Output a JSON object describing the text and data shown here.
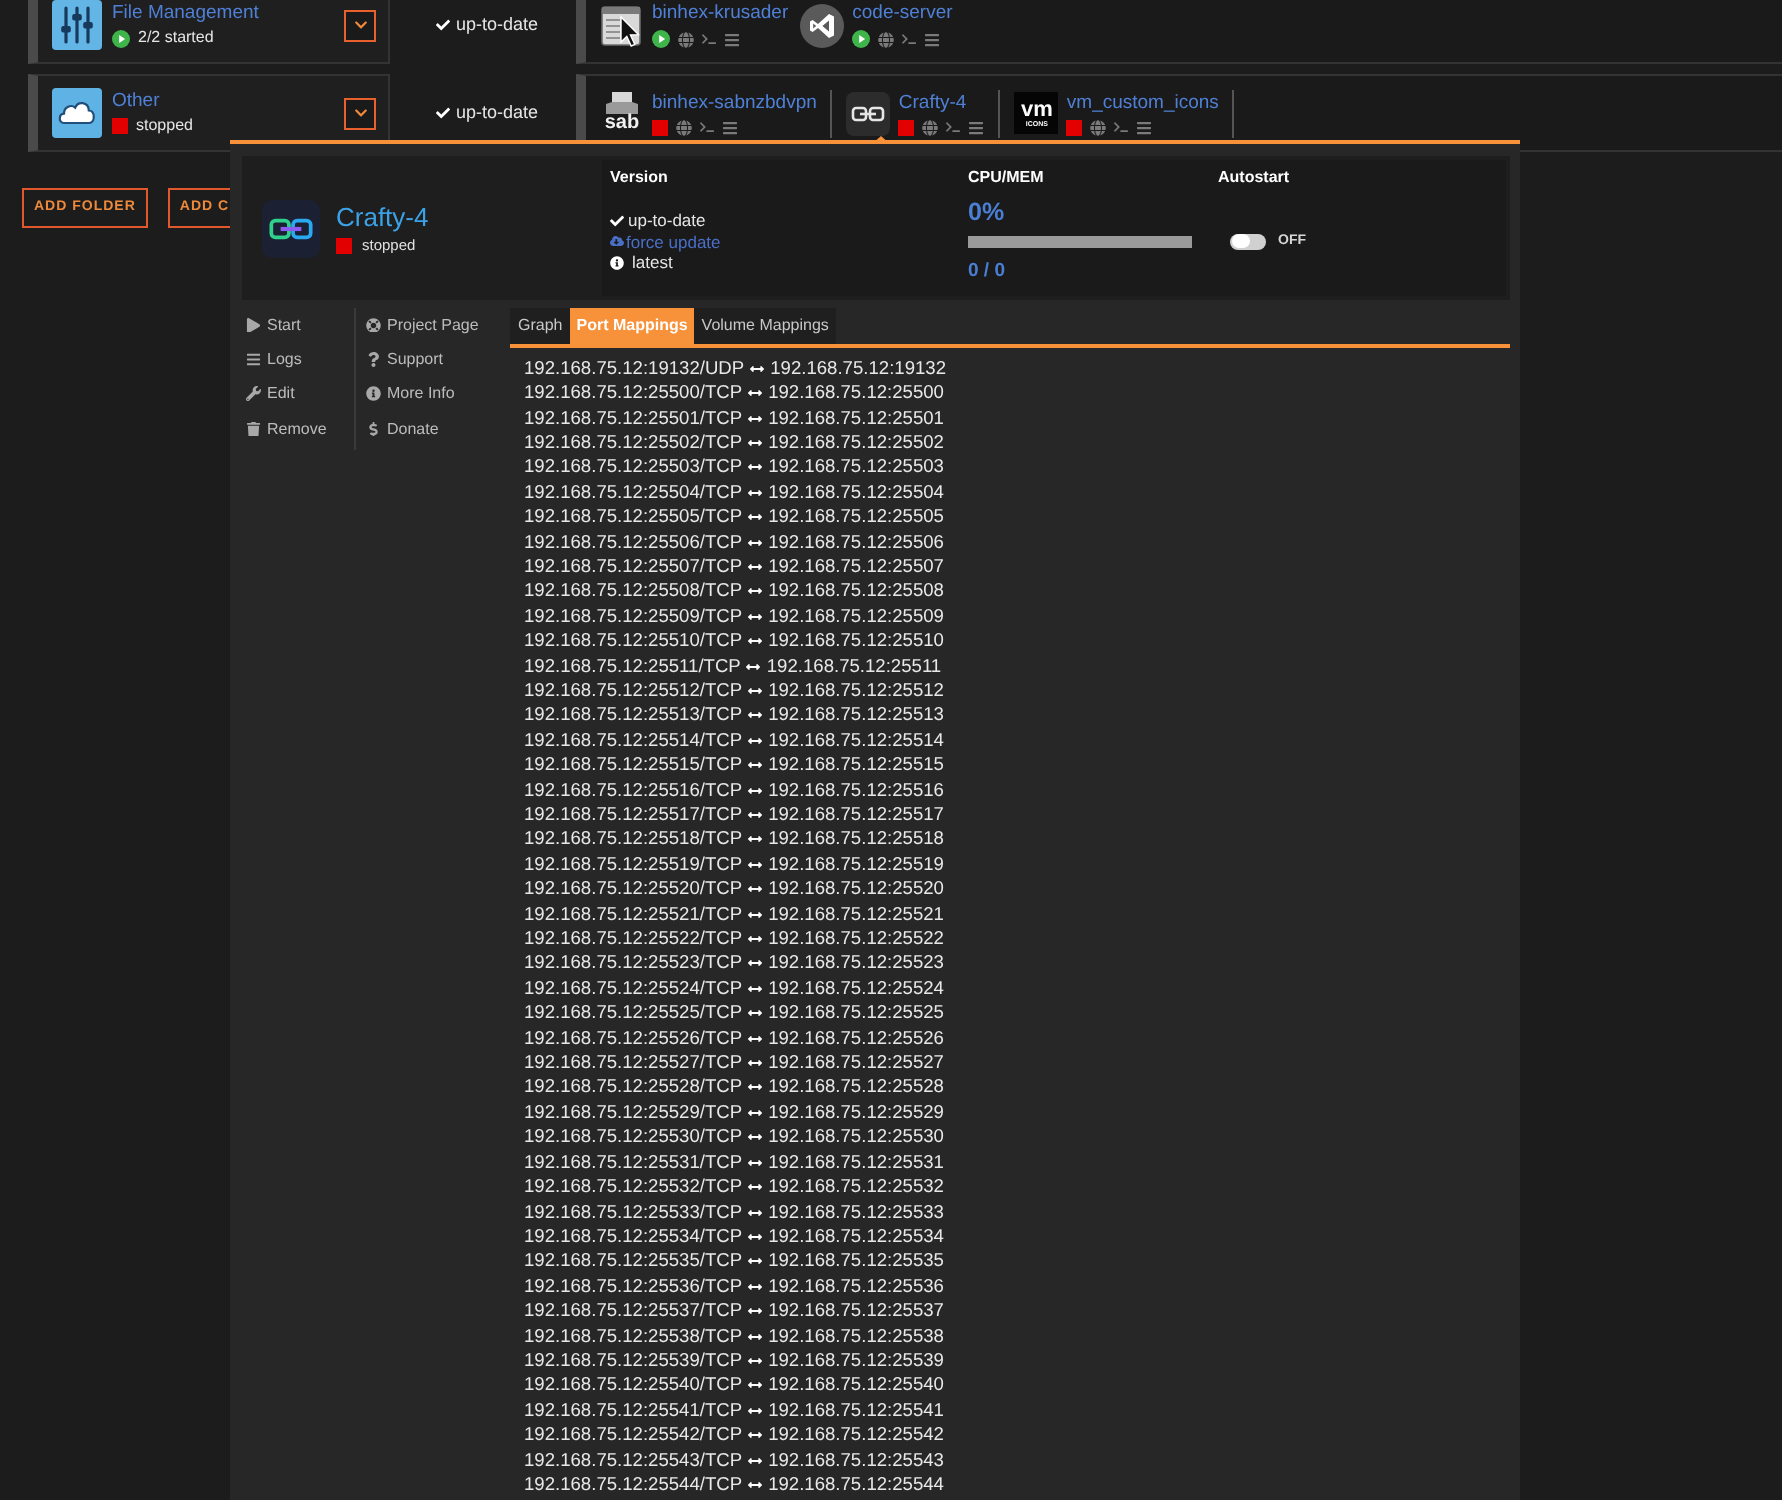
{
  "folders": [
    {
      "name": "File Management",
      "status": {
        "running": true,
        "text": "2/2 started"
      },
      "update": "up-to-date",
      "separators": false,
      "containers": [
        {
          "name": "binhex-krusader",
          "logo": {
            "kind": "krusader"
          },
          "running": true,
          "selected": false
        },
        {
          "name": "code-server",
          "logo": {
            "kind": "code"
          },
          "running": true,
          "selected": false
        }
      ]
    },
    {
      "name": "Other",
      "status": {
        "running": false,
        "text": "stopped"
      },
      "update": "up-to-date",
      "separators": true,
      "containers": [
        {
          "name": "binhex-sabnzbdvpn",
          "logo": {
            "kind": "sab",
            "text": [
              "sab"
            ]
          },
          "running": false,
          "selected": false
        },
        {
          "name": "Crafty-4",
          "logo": {
            "kind": "link"
          },
          "running": false,
          "selected": true
        },
        {
          "name": "vm_custom_icons",
          "logo": {
            "kind": "vm",
            "text": [
              "vm",
              "ICONS"
            ]
          },
          "running": false,
          "selected": false
        }
      ]
    }
  ],
  "buttons": [
    "ADD FOLDER",
    "ADD C"
  ],
  "popup": {
    "name": "Crafty-4",
    "running": false,
    "status": "stopped",
    "info": [
      {
        "kind": "version",
        "heading": "Version",
        "lines": [
          {
            "kind": "check",
            "text": "up-to-date"
          },
          {
            "kind": "link",
            "text": "force update"
          },
          {
            "kind": "info",
            "text": "latest"
          }
        ]
      },
      {
        "kind": "usage",
        "heading": "CPU/MEM",
        "cpu": "0%",
        "level": 0,
        "mem": "0 / 0"
      },
      {
        "kind": "toggle",
        "heading": "Autostart",
        "on": false,
        "label": "OFF"
      }
    ],
    "actions": [
      [
        "Start",
        "Logs",
        "Edit",
        "Remove"
      ],
      [
        "Project Page",
        "Support",
        "More Info",
        "Donate"
      ]
    ],
    "tabs": [
      {
        "label": "Graph",
        "selected": false
      },
      {
        "label": "Port Mappings",
        "selected": true
      },
      {
        "label": "Volume Mappings",
        "selected": false
      }
    ],
    "port_mappings": [
      {
        "host": "192.168.75.12:19132/UDP",
        "container": "192.168.75.12:19132"
      },
      {
        "host": "192.168.75.12:25500/TCP",
        "container": "192.168.75.12:25500"
      },
      {
        "host": "192.168.75.12:25501/TCP",
        "container": "192.168.75.12:25501"
      },
      {
        "host": "192.168.75.12:25502/TCP",
        "container": "192.168.75.12:25502"
      },
      {
        "host": "192.168.75.12:25503/TCP",
        "container": "192.168.75.12:25503"
      },
      {
        "host": "192.168.75.12:25504/TCP",
        "container": "192.168.75.12:25504"
      },
      {
        "host": "192.168.75.12:25505/TCP",
        "container": "192.168.75.12:25505"
      },
      {
        "host": "192.168.75.12:25506/TCP",
        "container": "192.168.75.12:25506"
      },
      {
        "host": "192.168.75.12:25507/TCP",
        "container": "192.168.75.12:25507"
      },
      {
        "host": "192.168.75.12:25508/TCP",
        "container": "192.168.75.12:25508"
      },
      {
        "host": "192.168.75.12:25509/TCP",
        "container": "192.168.75.12:25509"
      },
      {
        "host": "192.168.75.12:25510/TCP",
        "container": "192.168.75.12:25510"
      },
      {
        "host": "192.168.75.12:25511/TCP",
        "container": "192.168.75.12:25511"
      },
      {
        "host": "192.168.75.12:25512/TCP",
        "container": "192.168.75.12:25512"
      },
      {
        "host": "192.168.75.12:25513/TCP",
        "container": "192.168.75.12:25513"
      },
      {
        "host": "192.168.75.12:25514/TCP",
        "container": "192.168.75.12:25514"
      },
      {
        "host": "192.168.75.12:25515/TCP",
        "container": "192.168.75.12:25515"
      },
      {
        "host": "192.168.75.12:25516/TCP",
        "container": "192.168.75.12:25516"
      },
      {
        "host": "192.168.75.12:25517/TCP",
        "container": "192.168.75.12:25517"
      },
      {
        "host": "192.168.75.12:25518/TCP",
        "container": "192.168.75.12:25518"
      },
      {
        "host": "192.168.75.12:25519/TCP",
        "container": "192.168.75.12:25519"
      },
      {
        "host": "192.168.75.12:25520/TCP",
        "container": "192.168.75.12:25520"
      },
      {
        "host": "192.168.75.12:25521/TCP",
        "container": "192.168.75.12:25521"
      },
      {
        "host": "192.168.75.12:25522/TCP",
        "container": "192.168.75.12:25522"
      },
      {
        "host": "192.168.75.12:25523/TCP",
        "container": "192.168.75.12:25523"
      },
      {
        "host": "192.168.75.12:25524/TCP",
        "container": "192.168.75.12:25524"
      },
      {
        "host": "192.168.75.12:25525/TCP",
        "container": "192.168.75.12:25525"
      },
      {
        "host": "192.168.75.12:25526/TCP",
        "container": "192.168.75.12:25526"
      },
      {
        "host": "192.168.75.12:25527/TCP",
        "container": "192.168.75.12:25527"
      },
      {
        "host": "192.168.75.12:25528/TCP",
        "container": "192.168.75.12:25528"
      },
      {
        "host": "192.168.75.12:25529/TCP",
        "container": "192.168.75.12:25529"
      },
      {
        "host": "192.168.75.12:25530/TCP",
        "container": "192.168.75.12:25530"
      },
      {
        "host": "192.168.75.12:25531/TCP",
        "container": "192.168.75.12:25531"
      },
      {
        "host": "192.168.75.12:25532/TCP",
        "container": "192.168.75.12:25532"
      },
      {
        "host": "192.168.75.12:25533/TCP",
        "container": "192.168.75.12:25533"
      },
      {
        "host": "192.168.75.12:25534/TCP",
        "container": "192.168.75.12:25534"
      },
      {
        "host": "192.168.75.12:25535/TCP",
        "container": "192.168.75.12:25535"
      },
      {
        "host": "192.168.75.12:25536/TCP",
        "container": "192.168.75.12:25536"
      },
      {
        "host": "192.168.75.12:25537/TCP",
        "container": "192.168.75.12:25537"
      },
      {
        "host": "192.168.75.12:25538/TCP",
        "container": "192.168.75.12:25538"
      },
      {
        "host": "192.168.75.12:25539/TCP",
        "container": "192.168.75.12:25539"
      },
      {
        "host": "192.168.75.12:25540/TCP",
        "container": "192.168.75.12:25540"
      },
      {
        "host": "192.168.75.12:25541/TCP",
        "container": "192.168.75.12:25541"
      },
      {
        "host": "192.168.75.12:25542/TCP",
        "container": "192.168.75.12:25542"
      },
      {
        "host": "192.168.75.12:25543/TCP",
        "container": "192.168.75.12:25543"
      },
      {
        "host": "192.168.75.12:25544/TCP",
        "container": "192.168.75.12:25544"
      }
    ]
  }
}
